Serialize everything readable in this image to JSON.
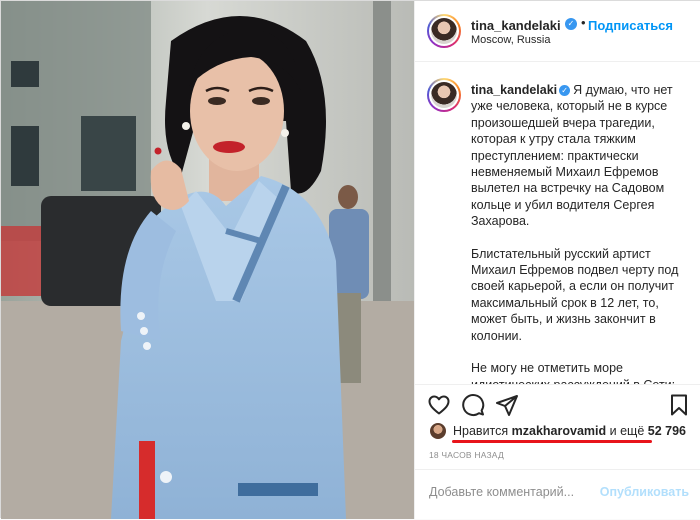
{
  "post": {
    "username": "tina_kandelaki",
    "follow_label": "Подписаться",
    "separator": "•",
    "location": "Moscow, Russia"
  },
  "caption": {
    "username": "tina_kandelaki",
    "verified_symbol": "✓",
    "paragraph1": "Я думаю, что нет уже человека, который не в курсе произошедшей вчера трагедии, которая к утру стала тяжким преступлением: практически невменяемый Михаил Ефремов вылетел на встречку на Садовом кольце и убил водителя Сергея Захарова.",
    "paragraph2": "Блистательный русский артист Михаил Ефремов подвел черту под своей карьерой, а если он получит максимальный срок в 12 лет, то, может быть, и жизнь закончит в колонии.",
    "paragraph3": "Не могу не отметить море идиотических рассуждений в Сети: от того, что это провокация, до того,"
  },
  "actions": {
    "like_icon": "heart-icon",
    "comment_icon": "comment-icon",
    "share_icon": "share-icon",
    "save_icon": "bookmark-icon"
  },
  "likes": {
    "prefix": "Нравится",
    "user": "mzakharovamid",
    "middle": "и ещё",
    "count": "52 796"
  },
  "timestamp": "18 ЧАСОВ НАЗАД",
  "comment": {
    "placeholder": "Добавьте комментарий...",
    "publish_label": "Опубликовать"
  },
  "colors": {
    "link_blue": "#0095f6",
    "verified_blue": "#3897f0",
    "underline_red": "#e8141b",
    "jacket_blue": "#9cbfe0"
  }
}
